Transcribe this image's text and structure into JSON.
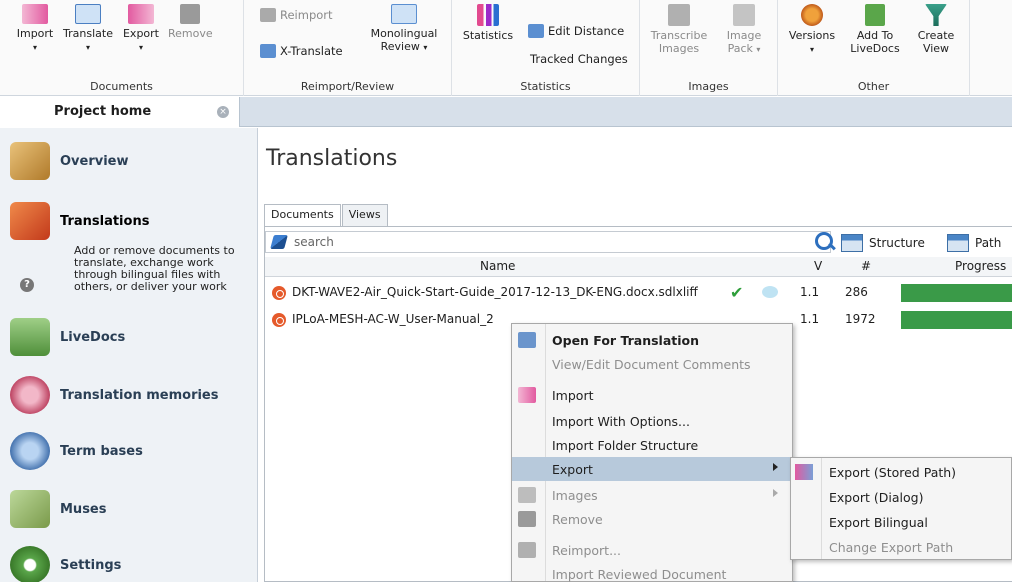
{
  "ribbon": {
    "groups": {
      "documents": "Documents",
      "reimport_review": "Reimport/Review",
      "statistics": "Statistics",
      "images": "Images",
      "other": "Other"
    },
    "buttons": {
      "import": "Import",
      "translate": "Translate",
      "export": "Export",
      "remove": "Remove",
      "reimport": "Reimport",
      "x_translate": "X-Translate",
      "monolingual_review": "Monolingual Review",
      "statistics": "Statistics",
      "edit_distance": "Edit Distance",
      "tracked_changes": "Tracked Changes",
      "transcribe_images": "Transcribe Images",
      "image_pack": "Image Pack",
      "versions": "Versions",
      "add_to_livedocs": "Add To LiveDocs",
      "create_view": "Create View"
    }
  },
  "tab": {
    "title": "Project home",
    "close": "×"
  },
  "sidebar": {
    "items": {
      "overview": "Overview",
      "translations": "Translations",
      "livedocs": "LiveDocs",
      "translation_memories": "Translation memories",
      "term_bases": "Term bases",
      "muses": "Muses",
      "settings": "Settings"
    },
    "translations_desc": "Add or remove documents to translate, exchange work through bilingual files with others, or deliver your work",
    "help": "?"
  },
  "main": {
    "title": "Translations",
    "tabs": {
      "documents": "Documents",
      "views": "Views"
    },
    "search_placeholder": "search",
    "tools": {
      "structure": "Structure",
      "path": "Path"
    },
    "columns": {
      "name": "Name",
      "version": "V",
      "count": "#",
      "progress": "Progress"
    },
    "rows": [
      {
        "name": "DKT-WAVE2-Air_Quick-Start-Guide_2017-12-13_DK-ENG.docx.sdlxliff",
        "version": "1.1",
        "count": "286",
        "progress": 1.0,
        "check": "✔"
      },
      {
        "name": "IPLoA-MESH-AC-W_User-Manual_2",
        "version": "1.1",
        "count": "1972",
        "progress": 1.0
      }
    ]
  },
  "context_menu": {
    "open_for_translation": "Open For Translation",
    "view_edit_comments": "View/Edit Document Comments",
    "import": "Import",
    "import_with_options": "Import With Options...",
    "import_folder_structure": "Import Folder Structure",
    "export": "Export",
    "images": "Images",
    "remove": "Remove",
    "reimport": "Reimport...",
    "import_reviewed": "Import Reviewed Document"
  },
  "export_submenu": {
    "stored_path": "Export (Stored Path)",
    "dialog": "Export (Dialog)",
    "bilingual": "Export Bilingual",
    "change_path": "Change Export Path"
  }
}
